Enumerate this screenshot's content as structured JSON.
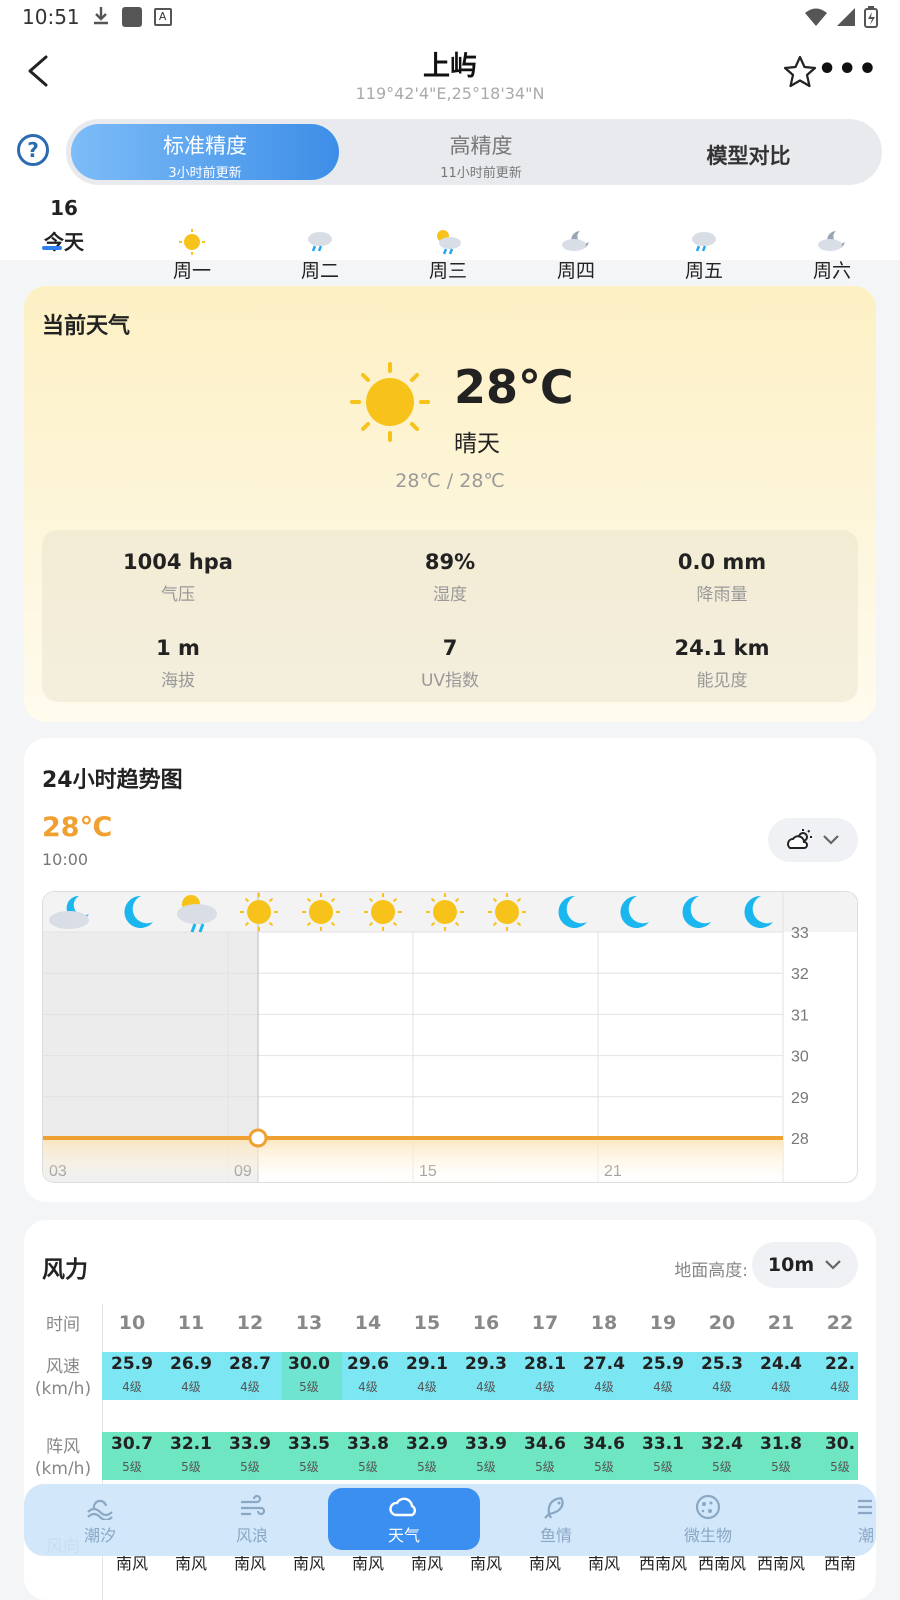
{
  "status": {
    "time": "10:51"
  },
  "header": {
    "title": "上屿",
    "coords": "119°42'4\"E,25°18'34\"N"
  },
  "precision": {
    "help": "?",
    "tabs": [
      {
        "label": "标准精度",
        "sub": "3小时前更新"
      },
      {
        "label": "高精度",
        "sub": "11小时前更新"
      },
      {
        "label": "模型对比",
        "sub": ""
      }
    ]
  },
  "days": [
    {
      "num": "16",
      "label": "今天",
      "icon": "none"
    },
    {
      "num": "",
      "label": "周一",
      "icon": "sun"
    },
    {
      "num": "",
      "label": "周二",
      "icon": "rain-cloud"
    },
    {
      "num": "",
      "label": "周三",
      "icon": "sun-rain"
    },
    {
      "num": "",
      "label": "周四",
      "icon": "moon-cloud"
    },
    {
      "num": "",
      "label": "周五",
      "icon": "rain-cloud"
    },
    {
      "num": "",
      "label": "周六",
      "icon": "moon-cloud"
    }
  ],
  "current": {
    "title": "当前天气",
    "temp": "28℃",
    "condition": "晴天",
    "range": "28℃ / 28℃",
    "stats": [
      {
        "value": "1004 hpa",
        "label": "气压"
      },
      {
        "value": "89%",
        "label": "湿度"
      },
      {
        "value": "0.0 mm",
        "label": "降雨量"
      },
      {
        "value": "1 m",
        "label": "海拔"
      },
      {
        "value": "7",
        "label": "UV指数"
      },
      {
        "value": "24.1 km",
        "label": "能见度"
      }
    ]
  },
  "trend": {
    "title": "24小时趋势图",
    "temp": "28℃",
    "time": "10:00"
  },
  "chart_data": {
    "type": "line",
    "x_ticks": [
      "03",
      "09",
      "15",
      "21"
    ],
    "y_ticks": [
      33,
      32,
      31,
      30,
      29,
      28
    ],
    "ylim": [
      28,
      33
    ],
    "series": [
      {
        "values": [
          28,
          28,
          28,
          28,
          28,
          28,
          28,
          28,
          28,
          28,
          28,
          28,
          28,
          28,
          28,
          28,
          28,
          28,
          28,
          28,
          28,
          28,
          28,
          28
        ]
      }
    ],
    "current_hour": "09",
    "hour_icons": [
      "moon-cloud",
      "moon",
      "rain-cloud",
      "sun",
      "sun",
      "sun",
      "sun",
      "sun",
      "moon",
      "moon",
      "moon",
      "moon"
    ],
    "colors": {
      "line": "#f0a030",
      "past_shade": "#ececec"
    }
  },
  "wind": {
    "title": "风力",
    "height_label": "地面高度:",
    "height_value": "10m",
    "row_labels": {
      "time": "时间",
      "speed": "风速",
      "speed_unit": "(km/h)",
      "gust": "阵风",
      "gust_unit": "(km/h)",
      "dir": "风向"
    },
    "columns": [
      {
        "hour": "10",
        "speed": "25.9",
        "level": "4级",
        "gust": "30.7",
        "glevel": "5级",
        "dir": "南风"
      },
      {
        "hour": "11",
        "speed": "26.9",
        "level": "4级",
        "gust": "32.1",
        "glevel": "5级",
        "dir": "南风"
      },
      {
        "hour": "12",
        "speed": "28.7",
        "level": "4级",
        "gust": "33.9",
        "glevel": "5级",
        "dir": "南风"
      },
      {
        "hour": "13",
        "speed": "30.0",
        "level": "5级",
        "gust": "33.5",
        "glevel": "5级",
        "dir": "南风"
      },
      {
        "hour": "14",
        "speed": "29.6",
        "level": "4级",
        "gust": "33.8",
        "glevel": "5级",
        "dir": "南风"
      },
      {
        "hour": "15",
        "speed": "29.1",
        "level": "4级",
        "gust": "32.9",
        "glevel": "5级",
        "dir": "南风"
      },
      {
        "hour": "16",
        "speed": "29.3",
        "level": "4级",
        "gust": "33.9",
        "glevel": "5级",
        "dir": "南风"
      },
      {
        "hour": "17",
        "speed": "28.1",
        "level": "4级",
        "gust": "34.6",
        "glevel": "5级",
        "dir": "南风"
      },
      {
        "hour": "18",
        "speed": "27.4",
        "level": "4级",
        "gust": "34.6",
        "glevel": "5级",
        "dir": "南风"
      },
      {
        "hour": "19",
        "speed": "25.9",
        "level": "4级",
        "gust": "33.1",
        "glevel": "5级",
        "dir": "西南风"
      },
      {
        "hour": "20",
        "speed": "25.3",
        "level": "4级",
        "gust": "32.4",
        "glevel": "5级",
        "dir": "西南风"
      },
      {
        "hour": "21",
        "speed": "24.4",
        "level": "4级",
        "gust": "31.8",
        "glevel": "5级",
        "dir": "西南风"
      },
      {
        "hour": "22",
        "speed": "22.",
        "level": "4级",
        "gust": "30.",
        "glevel": "5级",
        "dir": "西南"
      }
    ],
    "colors": {
      "speed_bar": "#7de6f3",
      "gust_bar": "#6ee6c2"
    }
  },
  "tabbar": [
    {
      "label": "潮汐",
      "icon": "tide-icon"
    },
    {
      "label": "风浪",
      "icon": "wind-wave-icon"
    },
    {
      "label": "天气",
      "icon": "cloud-icon"
    },
    {
      "label": "鱼情",
      "icon": "fish-icon"
    },
    {
      "label": "微生物",
      "icon": "microbe-icon"
    },
    {
      "label": "潮",
      "icon": "tide-list-icon"
    }
  ]
}
